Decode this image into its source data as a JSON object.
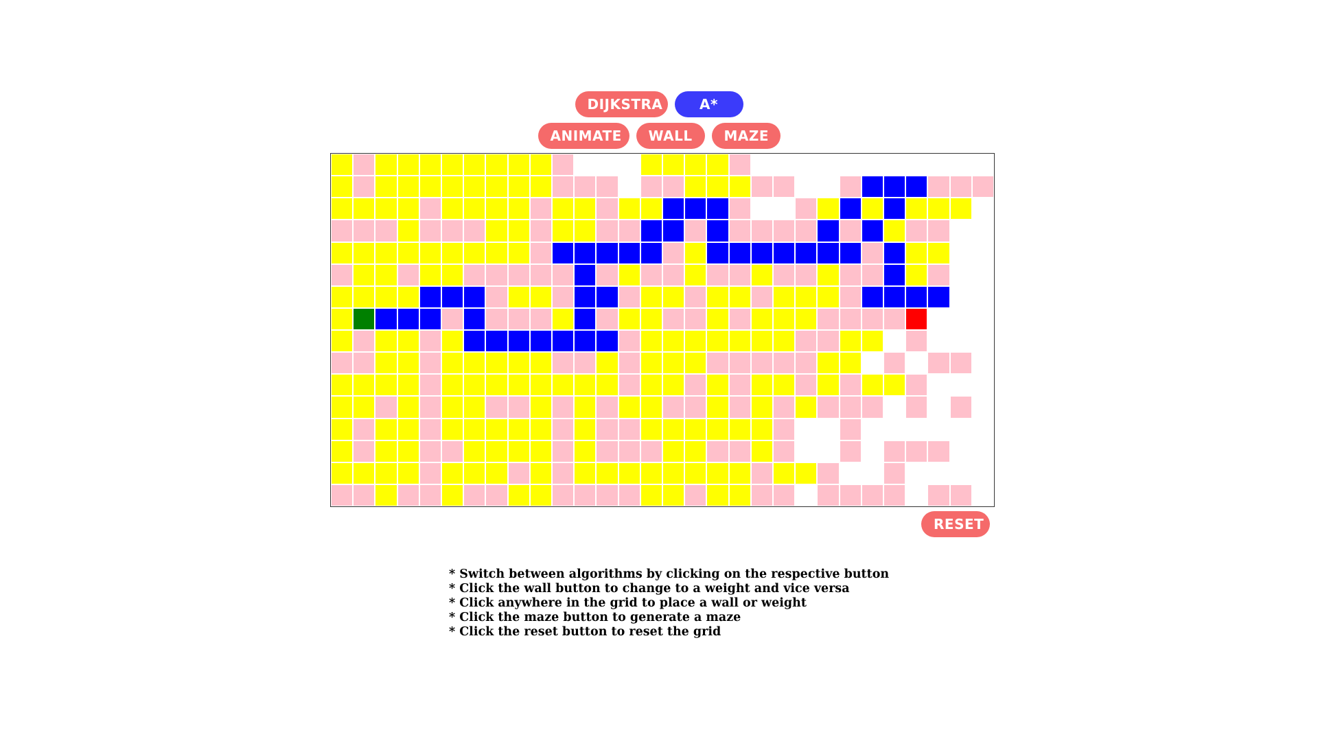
{
  "algorithm_buttons": [
    {
      "label": "DIJKSTRA",
      "active": false
    },
    {
      "label": "A*",
      "active": true
    }
  ],
  "control_buttons": [
    {
      "label": "ANIMATE"
    },
    {
      "label": "WALL"
    },
    {
      "label": "MAZE"
    }
  ],
  "reset_label": "RESET",
  "colors": {
    "button": "#f56a6a",
    "button_active": "#3b3bfa",
    "visited": "#ffff00",
    "wall": "#ffc0cb",
    "path": "#0000ff",
    "start": "#008000",
    "target": "#ff0000",
    "empty": "#ffffff"
  },
  "grid": {
    "columns": 30,
    "rows": 16,
    "legend": {
      "e": "empty",
      "y": "visited",
      "p": "wall",
      "b": "path",
      "s": "start",
      "t": "target"
    },
    "cells": [
      "ypyyyyyyyypeeeyyyypeeeeeeeeeee",
      "ypyyyyyyyypppeppyyyppeepbbbppp",
      "yyyypyyyypyypyybbbpeepybybyyye",
      "pppypppyypyyppbbpbppppbpbypp",
      "yyyyyyyyypbbbbbpybbbbbbbpbyye",
      "pyypyypppppbpyppyppyppyppbype",
      "yyyybbbpyypbbpyypyypyyypbbbb",
      "ysbbbpbpppybpyyppypyyyppppte",
      "ypyypybbbbbbbpyyyyyyyppyyepee",
      "ppyypyyyyyppypyyypppppyyepepp",
      "yyyypyyyyyyyypyypypyypypyypee",
      "yypypyyppypypyyppypypypppepep",
      "ypyypyyyyypyppyyyyyypeepeeee",
      "ypyyppyyyypypppyyppypeepeppp",
      "yyyypyyypypyyyyyyyypyypeepeeee",
      "ppyppyppyyppppyypyyppeppppepp"
    ]
  },
  "instructions": [
    "* Switch between algorithms by clicking on the respective button",
    "* Click the wall button to change to a weight and vice versa",
    "* Click anywhere in the grid to place a wall or weight",
    "* Click the maze button to generate a maze",
    "* Click the reset button to reset the grid"
  ]
}
